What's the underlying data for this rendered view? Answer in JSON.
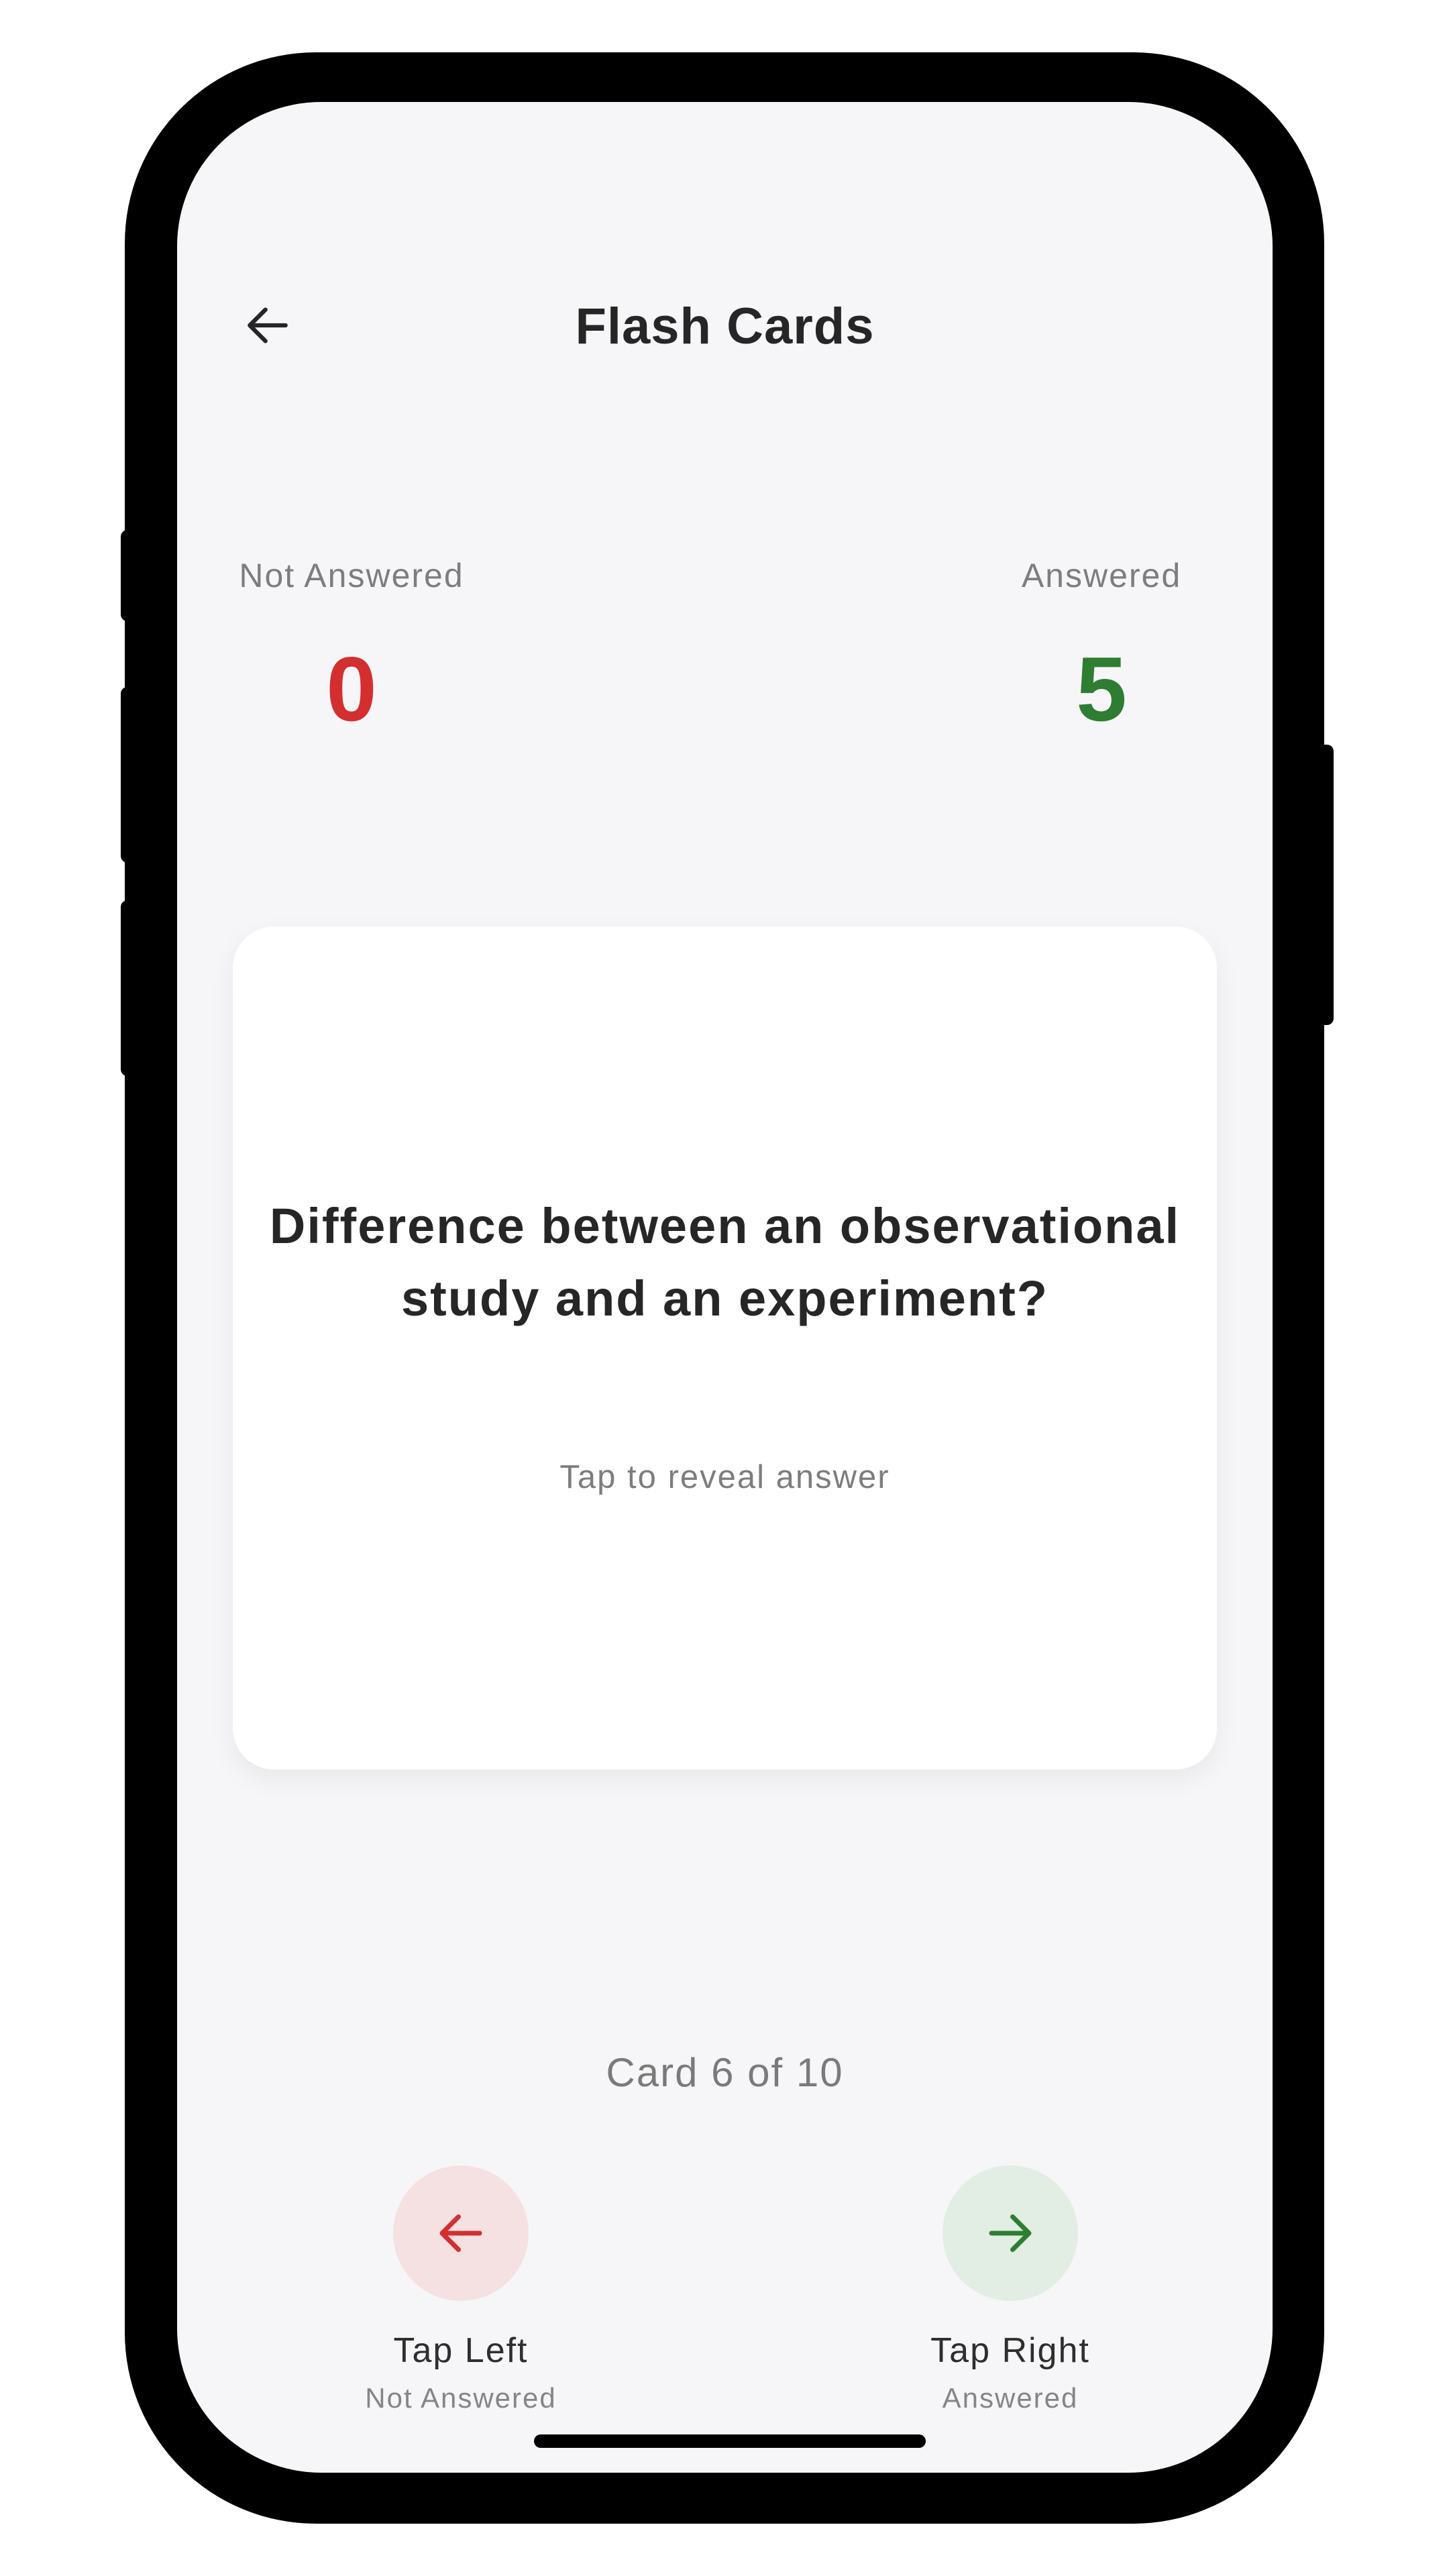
{
  "header": {
    "title": "Flash Cards",
    "back_icon": "arrow-left-icon"
  },
  "stats": {
    "not_answered": {
      "label": "Not Answered",
      "value": "0",
      "color": "#d32f2f"
    },
    "answered": {
      "label": "Answered",
      "value": "5",
      "color": "#2e7d32"
    }
  },
  "card": {
    "question": "Difference between an observational study and an experiment?",
    "hint": "Tap to reveal answer"
  },
  "progress": {
    "text": "Card 6 of 10",
    "current": 6,
    "total": 10
  },
  "actions": {
    "left": {
      "icon": "arrow-left-icon",
      "label": "Tap Left",
      "sublabel": "Not Answered",
      "color": "#d32f2f",
      "bg": "#f5e1e2"
    },
    "right": {
      "icon": "arrow-right-icon",
      "label": "Tap Right",
      "sublabel": "Answered",
      "color": "#2e7d32",
      "bg": "#e2ede3"
    }
  }
}
